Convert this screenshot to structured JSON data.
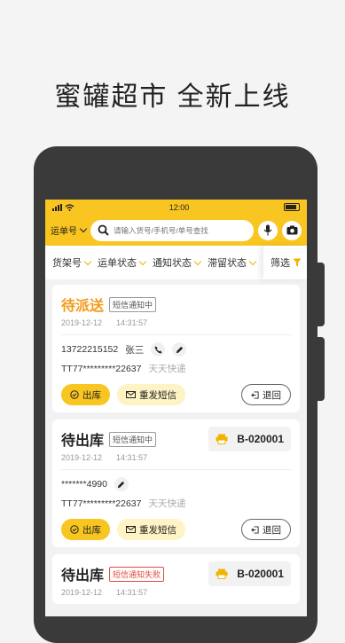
{
  "headline": "蜜罐超市 全新上线",
  "status_bar": {
    "time": "12:00"
  },
  "topbar": {
    "order_selector": "运单号",
    "search_placeholder": "请输入货号/手机号/单号查找",
    "mic_icon": "microphone-icon",
    "camera_icon": "camera-icon"
  },
  "filters": {
    "items": [
      "货架号",
      "运单状态",
      "通知状态",
      "滞留状态"
    ],
    "screen_label": "筛选"
  },
  "cards": [
    {
      "state": "待派送",
      "tag": "短信通知中",
      "date": "2019-12-12",
      "time": "14:31:57",
      "phone": "13722215152",
      "name": "张三",
      "tracking": "TT77*********22637",
      "courier": "天天快递",
      "btn_out": "出库",
      "btn_sms": "重发短信",
      "btn_back": "退回"
    },
    {
      "state": "待出库",
      "tag": "短信通知中",
      "shelf": "B-020001",
      "date": "2019-12-12",
      "time": "14:31:57",
      "phone": "*******4990",
      "tracking": "TT77*********22637",
      "courier": "天天快递",
      "btn_out": "出库",
      "btn_sms": "重发短信",
      "btn_back": "退回"
    },
    {
      "state": "待出库",
      "tag": "短信通知失败",
      "shelf": "B-020001",
      "date": "2019-12-12",
      "time": "14:31:57"
    }
  ],
  "colors": {
    "accent": "#f9c520",
    "orange": "#f39a1a",
    "fail": "#e04b3f"
  }
}
